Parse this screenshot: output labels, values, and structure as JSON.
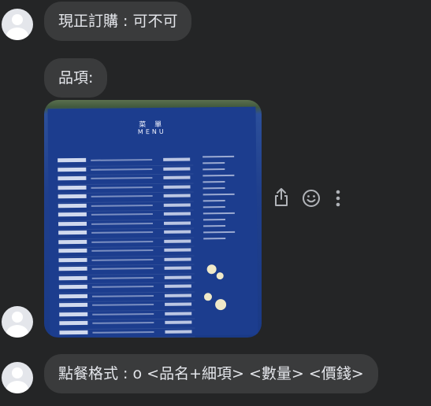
{
  "messages": [
    {
      "text": "現正訂購 : 可不可"
    },
    {
      "text": "品項:"
    },
    {
      "text": "點餐格式 : o <品名+細項> <數量> <價錢>"
    }
  ],
  "photo": {
    "title": "菜 單",
    "subtitle": "MENU"
  },
  "icons": [
    "share-icon",
    "smiley-icon",
    "more-icon"
  ],
  "colors": {
    "background": "#242526",
    "bubble": "#3a3b3c",
    "text": "#e4e6eb",
    "icon": "#b0b3b8"
  }
}
